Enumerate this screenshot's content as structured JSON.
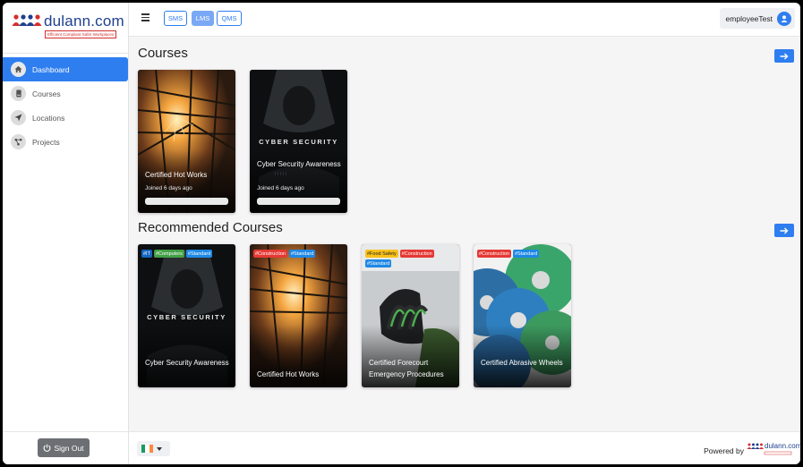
{
  "brand": {
    "name": "dulann.com",
    "tagline": "Efficient Compliant Safer Workplaces",
    "color_primary": "#1f3f8f",
    "color_accent": "#d32f2f"
  },
  "sidebar": {
    "items": [
      {
        "label": "Dashboard",
        "icon": "home-icon",
        "active": true
      },
      {
        "label": "Courses",
        "icon": "book-icon",
        "active": false
      },
      {
        "label": "Locations",
        "icon": "location-arrow-icon",
        "active": false
      },
      {
        "label": "Projects",
        "icon": "project-nodes-icon",
        "active": false
      }
    ],
    "signout_label": "Sign Out"
  },
  "topbar": {
    "modules": [
      {
        "label": "SMS",
        "active": false
      },
      {
        "label": "LMS",
        "active": true
      },
      {
        "label": "QMS",
        "active": false
      }
    ],
    "username": "employeeTest"
  },
  "courses": {
    "title": "Courses",
    "items": [
      {
        "title": "Certified Hot Works",
        "joined": "Joined 6 days ago",
        "image": "hot-works"
      },
      {
        "title": "Cyber Security Awareness",
        "joined": "Joined 6 days ago",
        "image": "cyber-security",
        "image_text": "CYBER SECURITY"
      }
    ]
  },
  "recommended": {
    "title": "Recommended Courses",
    "items": [
      {
        "title": "Cyber Security Awareness",
        "image": "cyber-security",
        "image_text": "CYBER SECURITY",
        "tags": [
          {
            "label": "#IT",
            "color": "#1565c0"
          },
          {
            "label": "#Computers",
            "color": "#43a047"
          },
          {
            "label": "#Standard",
            "color": "#1e88e5"
          }
        ]
      },
      {
        "title": "Certified Hot Works",
        "image": "hot-works",
        "tags": [
          {
            "label": "#Construction",
            "color": "#e53935"
          },
          {
            "label": "#Standard",
            "color": "#1e88e5"
          }
        ]
      },
      {
        "title": "Certified Forecourt Emergency Procedures",
        "image": "forecourt",
        "tags": [
          {
            "label": "#Food Safety",
            "color": "#f9c21a"
          },
          {
            "label": "#Construction",
            "color": "#e53935"
          },
          {
            "label": "#Standard",
            "color": "#1e88e5"
          }
        ]
      },
      {
        "title": "Certified Abrasive Wheels",
        "image": "abrasive-wheels",
        "tags": [
          {
            "label": "#Construction",
            "color": "#e53935"
          },
          {
            "label": "#Standard",
            "color": "#1e88e5"
          }
        ]
      }
    ]
  },
  "footer": {
    "powered_by": "Powered by",
    "language_flag": "ireland-flag-icon"
  },
  "colors": {
    "accent": "#2f7ef0"
  }
}
